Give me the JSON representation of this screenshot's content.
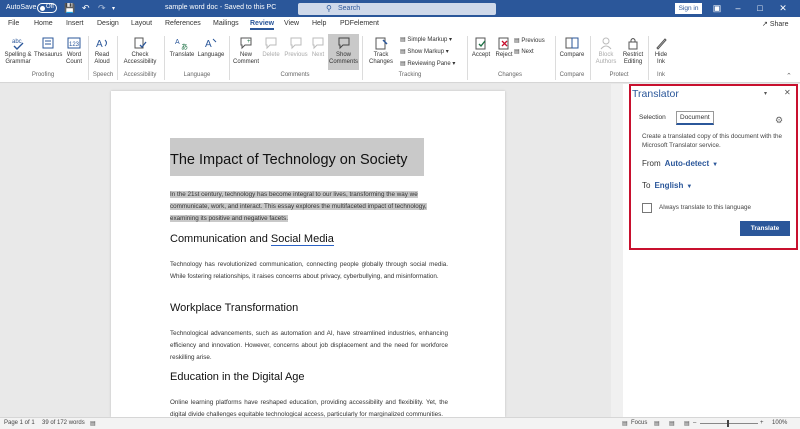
{
  "titlebar": {
    "autosave_label": "AutoSave",
    "autosave_state": "Off",
    "doc_title": "sample word doc  -  Saved to this PC",
    "search_placeholder": "Search",
    "signin_label": "Sign in",
    "qat_icons": [
      "save-icon",
      "undo-icon",
      "redo-icon"
    ]
  },
  "menu": {
    "tabs": [
      "File",
      "Home",
      "Insert",
      "Design",
      "Layout",
      "References",
      "Mailings",
      "Review",
      "View",
      "Help",
      "PDFelement"
    ],
    "active_tab": "Review",
    "share_label": "Share"
  },
  "ribbon": {
    "proofing": {
      "label": "Proofing",
      "spelling": "Spelling & Grammar",
      "thesaurus": "Thesaurus",
      "word_count": "Word Count"
    },
    "speech": {
      "label": "Speech",
      "read_aloud": "Read Aloud"
    },
    "accessibility": {
      "label": "Accessibility",
      "check": "Check Accessibility"
    },
    "language": {
      "label": "Language",
      "translate": "Translate",
      "language": "Language"
    },
    "comments": {
      "label": "Comments",
      "new": "New Comment",
      "delete": "Delete",
      "previous": "Previous",
      "next": "Next",
      "show": "Show Comments"
    },
    "tracking": {
      "label": "Tracking",
      "track_changes": "Track Changes",
      "simple_markup": "Simple Markup",
      "show_markup": "Show Markup",
      "reviewing_pane": "Reviewing Pane"
    },
    "changes": {
      "label": "Changes",
      "accept": "Accept",
      "reject": "Reject",
      "previous": "Previous",
      "next": "Next"
    },
    "compare": {
      "label": "Compare",
      "compare": "Compare"
    },
    "protect": {
      "label": "Protect",
      "block_authors": "Block Authors",
      "restrict_editing": "Restrict Editing"
    },
    "ink": {
      "label": "Ink",
      "hide_ink": "Hide Ink"
    }
  },
  "document": {
    "title": "The Impact of Technology on Society",
    "intro_lines": [
      "In the 21st century, technology has become integral to our lives, transforming the way we",
      "communicate, work, and interact. This essay explores the multifaceted impact of technology,",
      "examining its positive and negative facets."
    ],
    "sections": [
      {
        "heading_a": "Communication and ",
        "heading_b": "Social Media",
        "body": "Technology has revolutionized communication, connecting people globally through social media. While fostering relationships, it raises concerns about privacy, cyberbullying, and misinformation."
      },
      {
        "heading": "Workplace Transformation",
        "body": "Technological advancements, such as automation and AI, have streamlined industries, enhancing efficiency and innovation. However, concerns about job displacement and the need for workforce reskilling arise."
      },
      {
        "heading": "Education in the Digital Age",
        "body": "Online learning platforms have reshaped education, providing accessibility and flexibility. Yet, the digital divide challenges equitable technological access, particularly for marginalized communities."
      }
    ]
  },
  "translator": {
    "title": "Translator",
    "tab_selection": "Selection",
    "tab_document": "Document",
    "active_tab": "Document",
    "description": "Create a translated copy of this document with the Microsoft Translator service.",
    "from_label": "From",
    "from_value": "Auto-detect",
    "to_label": "To",
    "to_value": "English",
    "always_translate_label": "Always translate to this language",
    "always_translate_checked": false,
    "translate_button": "Translate",
    "highlight_color": "#c8102e"
  },
  "statusbar": {
    "page": "Page 1 of 1",
    "words": "39 of 172 words",
    "focus": "Focus",
    "zoom": "100%"
  },
  "colors": {
    "brand": "#2b579a",
    "highlight_frame": "#c8102e",
    "selection": "#c9c9c9"
  }
}
